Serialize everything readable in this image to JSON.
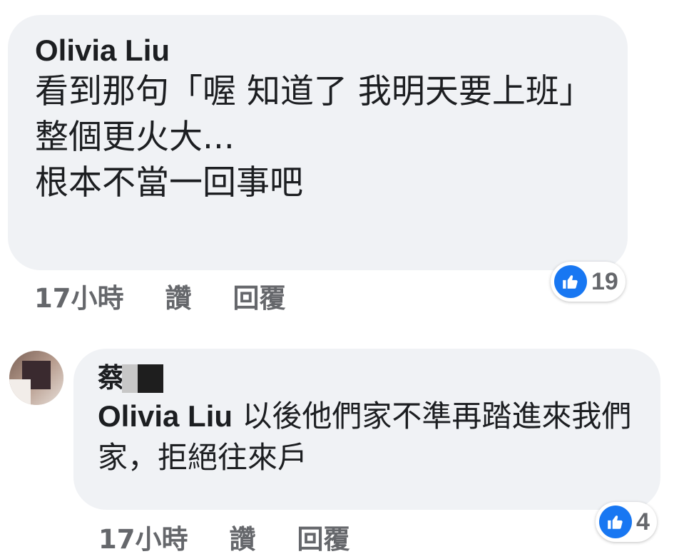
{
  "comments": [
    {
      "author": "Olivia Liu",
      "text": "看到那句「喔 知道了 我明天要上班」\n整個更火大...\n根本不當一回事吧",
      "time": "17小時",
      "like_label": "讚",
      "reply_label": "回覆",
      "reaction_count": "19",
      "reaction_icon": "thumbs-up-icon"
    },
    {
      "author": "蔡",
      "mention": "Olivia Liu",
      "text": " 以後他們家不準再踏進來我們家，拒絕往來戶",
      "time": "17小時",
      "like_label": "讚",
      "reply_label": "回覆",
      "reaction_count": "4",
      "reaction_icon": "thumbs-up-icon"
    }
  ],
  "colors": {
    "bubble_bg": "#f0f2f5",
    "meta_text": "#65676b",
    "like_blue": "#1877f2"
  }
}
